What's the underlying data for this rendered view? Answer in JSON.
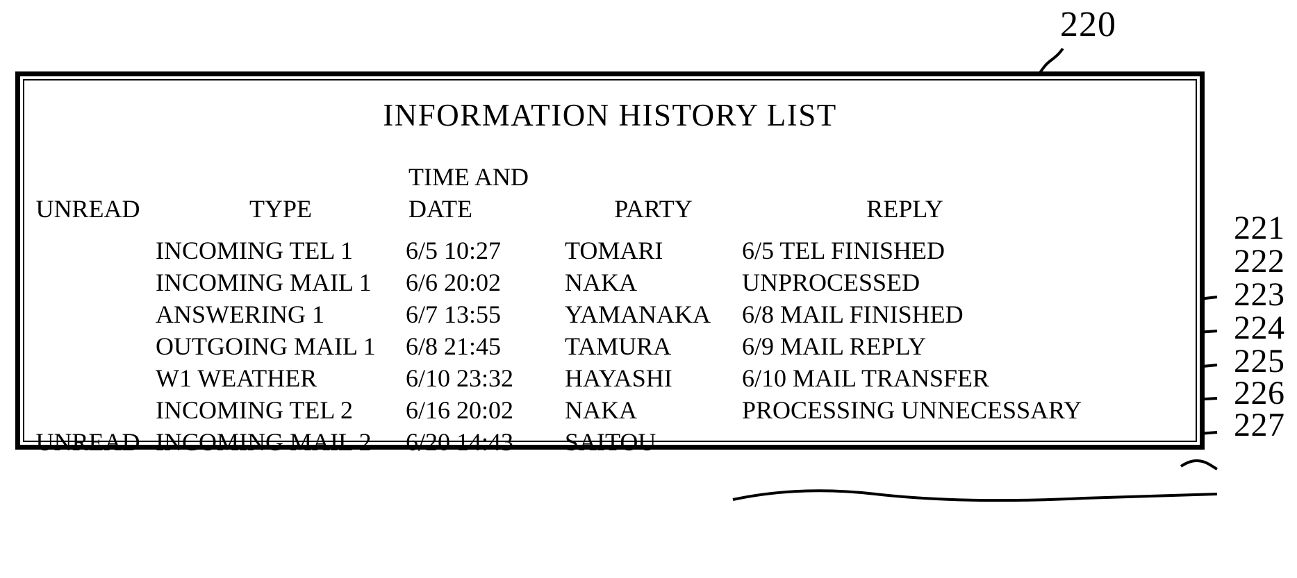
{
  "figure": {
    "top_reference_numeral": "220",
    "ink_color": "#000000",
    "background_color": "#ffffff"
  },
  "panel": {
    "title": "INFORMATION HISTORY LIST"
  },
  "table": {
    "headers": {
      "unread": "UNREAD",
      "type": "TYPE",
      "time_and_date_line1": "TIME AND",
      "time_and_date_line2": "DATE",
      "party": "PARTY",
      "reply": "REPLY"
    },
    "rows": [
      {
        "unread": "",
        "type": "INCOMING TEL 1",
        "time": "6/5 10:27",
        "party": "TOMARI",
        "reply": "6/5 TEL FINISHED",
        "ref": "221"
      },
      {
        "unread": "",
        "type": "INCOMING MAIL 1",
        "time": "6/6 20:02",
        "party": "NAKA",
        "reply": "UNPROCESSED",
        "ref": "222"
      },
      {
        "unread": "",
        "type": "ANSWERING 1",
        "time": "6/7 13:55",
        "party": "YAMANAKA",
        "reply": "6/8 MAIL FINISHED",
        "ref": "223"
      },
      {
        "unread": "",
        "type": "OUTGOING MAIL 1",
        "time": "6/8 21:45",
        "party": "TAMURA",
        "reply": "6/9 MAIL REPLY",
        "ref": "224"
      },
      {
        "unread": "",
        "type": "W1 WEATHER",
        "time": "6/10 23:32",
        "party": "HAYASHI",
        "reply": "6/10 MAIL TRANSFER",
        "ref": "225"
      },
      {
        "unread": "",
        "type": "INCOMING TEL 2",
        "time": "6/16 20:02",
        "party": "NAKA",
        "reply": "PROCESSING UNNECESSARY",
        "ref": "226"
      },
      {
        "unread": "UNREAD",
        "type": "INCOMING MAIL 2",
        "time": "6/20 14:43",
        "party": "SAITOU",
        "reply": "",
        "ref": "227"
      }
    ]
  }
}
